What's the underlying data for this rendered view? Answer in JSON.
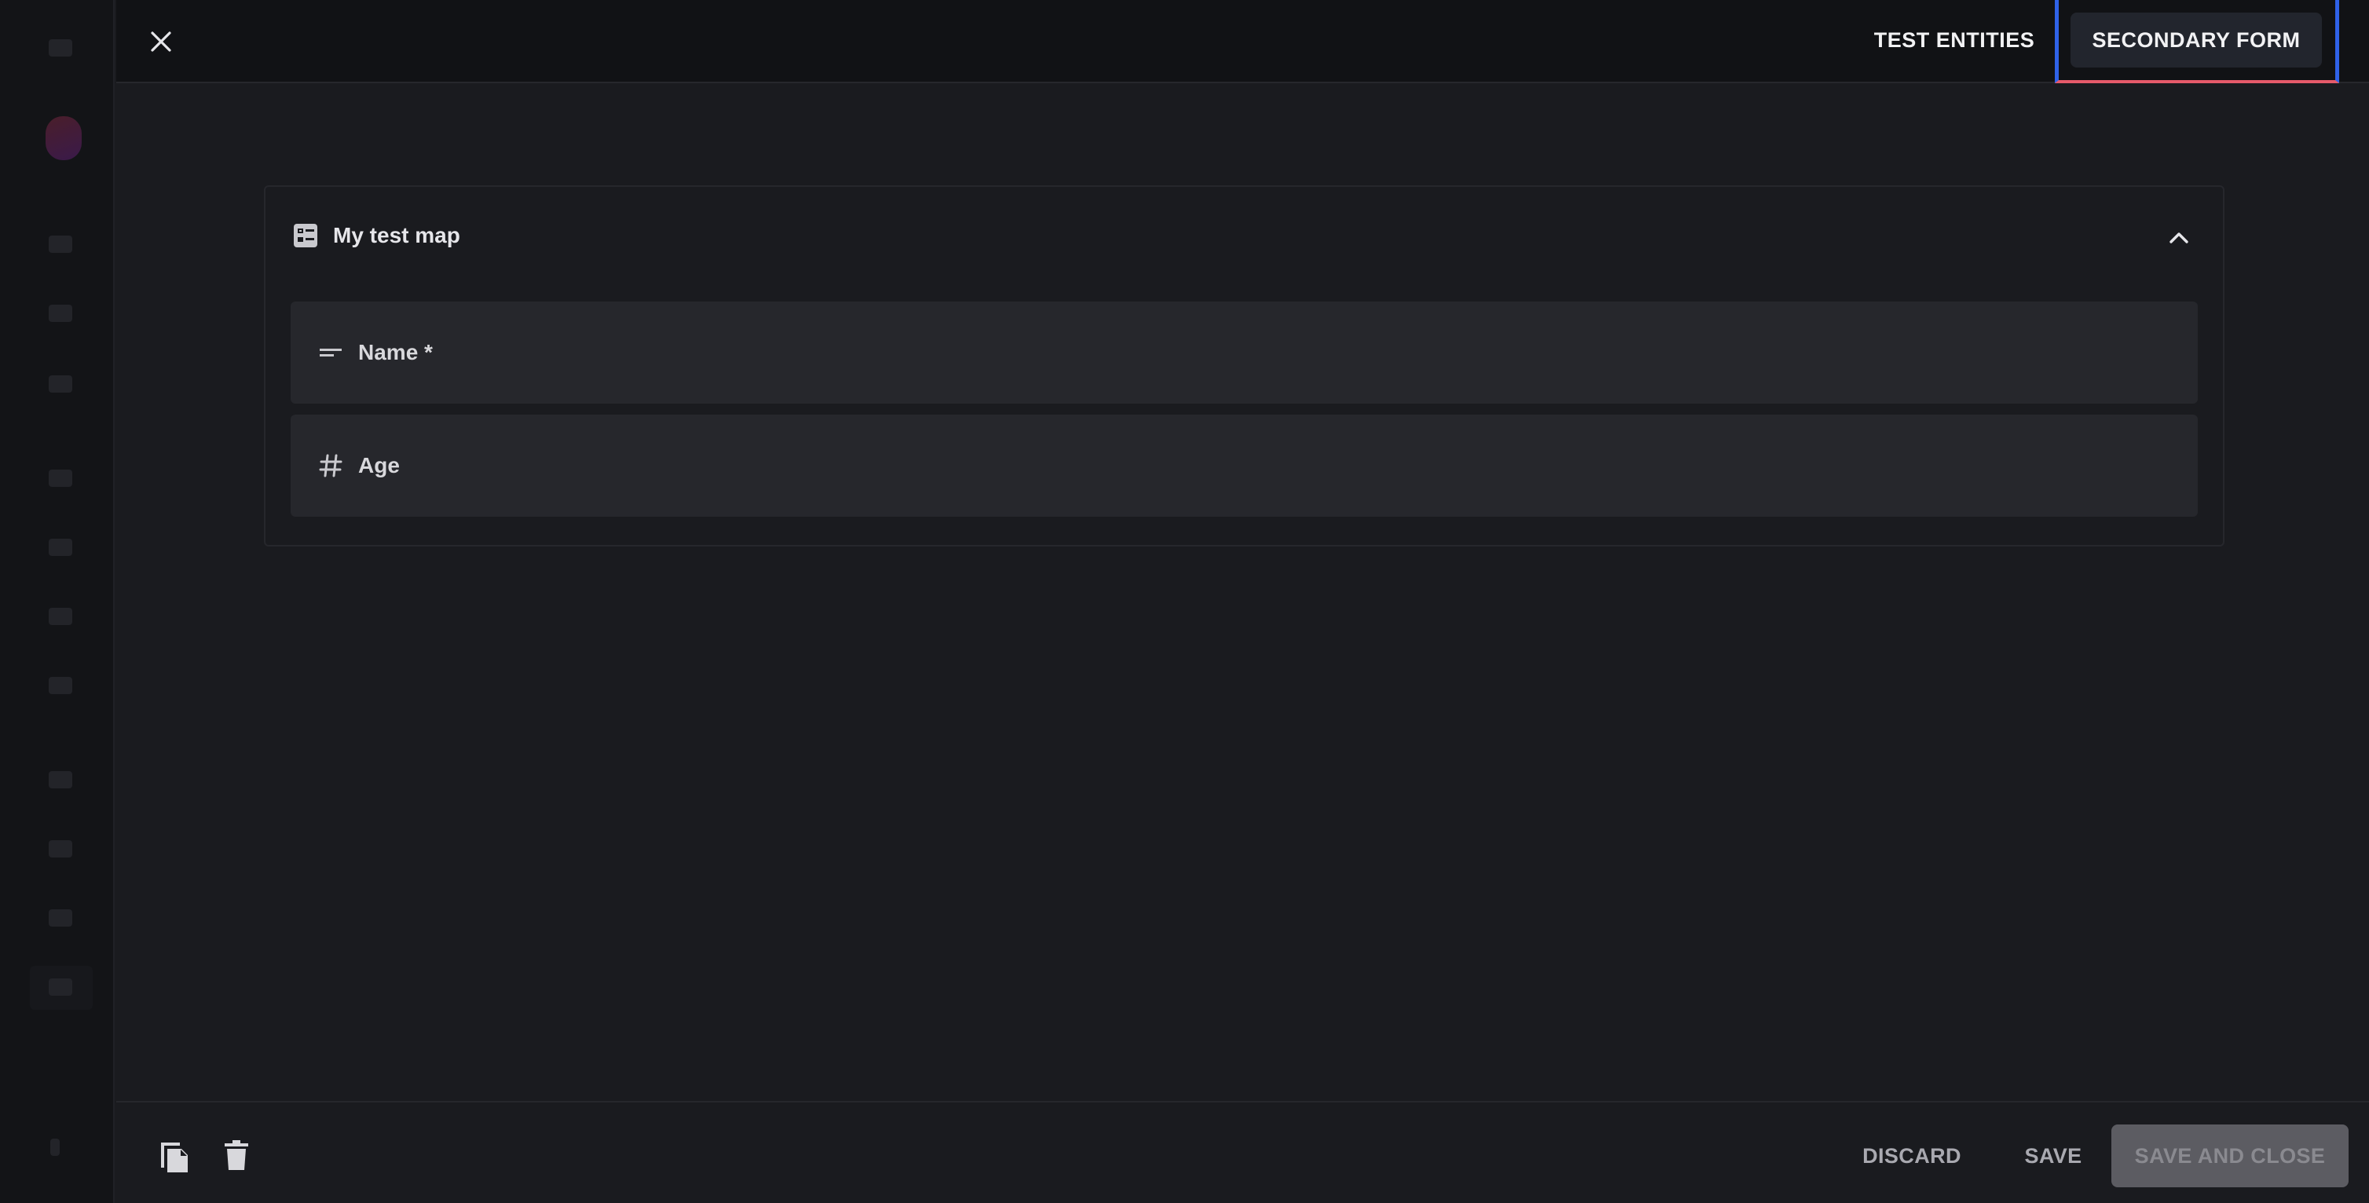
{
  "header": {
    "tabs": [
      {
        "label": "TEST ENTITIES"
      },
      {
        "label": "SECONDARY FORM"
      }
    ]
  },
  "card": {
    "title": "My test map",
    "fields": [
      {
        "label": "Name *",
        "icon": "short-text-icon"
      },
      {
        "label": "Age",
        "icon": "hash-icon"
      }
    ]
  },
  "footer": {
    "discard_label": "DISCARD",
    "save_label": "SAVE",
    "save_close_label": "SAVE AND CLOSE"
  },
  "colors": {
    "background": "#1a1b1f",
    "topbar": "#111215",
    "field": "#26272c",
    "focus_ring": "#2f62e8",
    "focus_underline": "#e65a6a",
    "disabled_button": "#5c5c62"
  }
}
